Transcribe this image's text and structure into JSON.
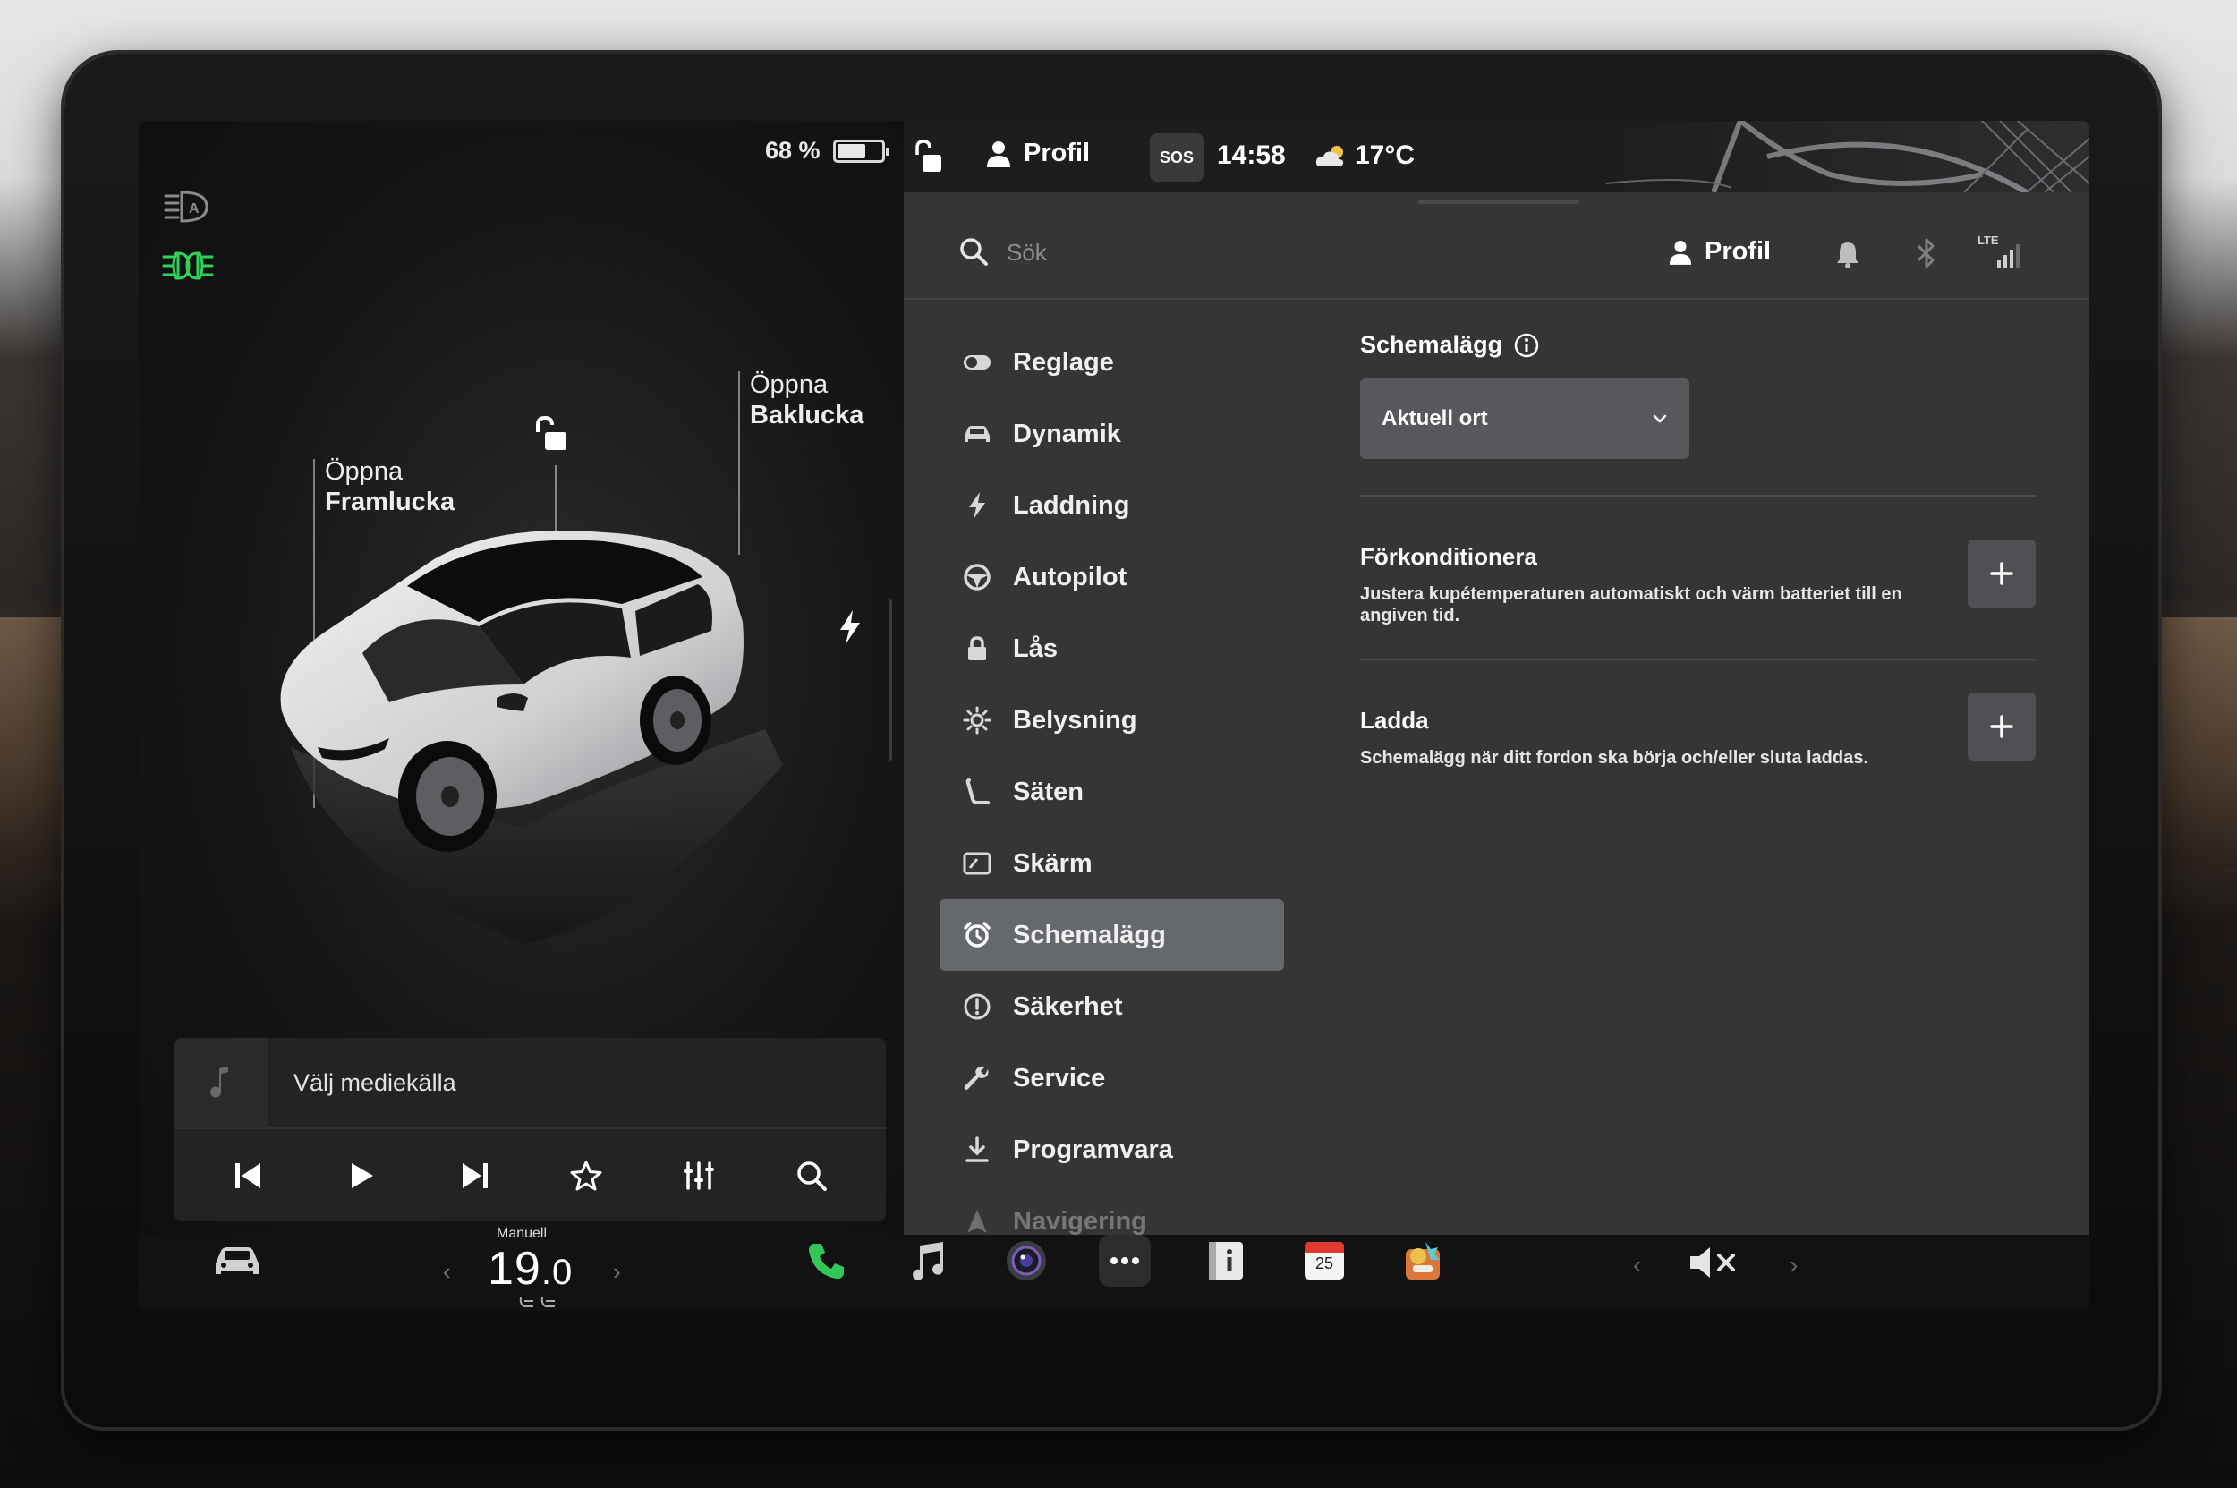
{
  "left": {
    "battery_percent": "68 %",
    "battery_level": 0.68,
    "front_trunk": {
      "line1": "Öppna",
      "line2": "Framlucka"
    },
    "rear_trunk": {
      "line1": "Öppna",
      "line2": "Baklucka"
    },
    "media_source_label": "Välj mediekälla"
  },
  "status_bar": {
    "profile": "Profil",
    "sos": "SOS",
    "time": "14:58",
    "temperature": "17°C"
  },
  "header": {
    "search_placeholder": "Sök",
    "profile": "Profil",
    "network": "LTE"
  },
  "nav": {
    "items": [
      {
        "label": "Reglage",
        "icon": "toggle-icon"
      },
      {
        "label": "Dynamik",
        "icon": "car-icon"
      },
      {
        "label": "Laddning",
        "icon": "bolt-icon"
      },
      {
        "label": "Autopilot",
        "icon": "steering-wheel-icon"
      },
      {
        "label": "Lås",
        "icon": "lock-icon"
      },
      {
        "label": "Belysning",
        "icon": "sun-icon"
      },
      {
        "label": "Säten",
        "icon": "seat-icon"
      },
      {
        "label": "Skärm",
        "icon": "display-icon"
      },
      {
        "label": "Schemalägg",
        "icon": "alarm-clock-icon",
        "active": true
      },
      {
        "label": "Säkerhet",
        "icon": "alert-circle-icon"
      },
      {
        "label": "Service",
        "icon": "wrench-icon"
      },
      {
        "label": "Programvara",
        "icon": "download-icon"
      },
      {
        "label": "Navigering",
        "icon": "navigation-icon"
      }
    ]
  },
  "content": {
    "title": "Schemalägg",
    "location_dropdown": "Aktuell ort",
    "precondition": {
      "title": "Förkonditionera",
      "description": "Justera kupétemperaturen automatiskt och värm batteriet till en angiven tid."
    },
    "charge": {
      "title": "Ladda",
      "description": "Schemalägg när ditt fordon ska börja och/eller sluta laddas."
    }
  },
  "dock": {
    "climate_mode": "Manuell",
    "temp_whole": "19",
    "temp_decimal": ".0",
    "calendar_day": "25"
  },
  "colors": {
    "headlight_green": "#2fd35a",
    "phone_green": "#33c759",
    "active_nav_bg": "#65686c",
    "calendar_red": "#e03b32"
  }
}
